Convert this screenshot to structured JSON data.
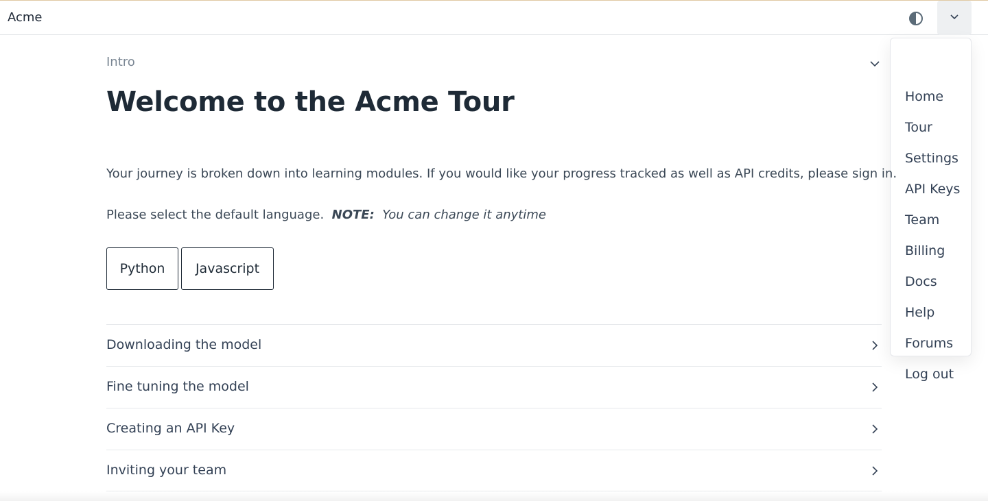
{
  "app": {
    "brand": "Acme"
  },
  "header": {
    "theme_icon": "contrast-icon",
    "menu_icon": "chevron-down-icon"
  },
  "menu": {
    "items": [
      {
        "label": "Home"
      },
      {
        "label": "Tour"
      },
      {
        "label": "Settings"
      },
      {
        "label": "API Keys"
      },
      {
        "label": "Team"
      },
      {
        "label": "Billing"
      },
      {
        "label": "Docs"
      },
      {
        "label": "Help"
      },
      {
        "label": "Forums"
      },
      {
        "label": "Log out"
      }
    ]
  },
  "section": {
    "label": "Intro",
    "title": "Welcome to the Acme Tour",
    "description": "Your journey is broken down into learning modules. If you would like your progress tracked as well as API credits, please sign in.",
    "language_prompt": "Please select the default language.",
    "note_label": "NOTE:",
    "note_text": "You can change it anytime"
  },
  "languages": [
    {
      "label": "Python"
    },
    {
      "label": "Javascript"
    }
  ],
  "modules": [
    {
      "label": "Downloading the model"
    },
    {
      "label": "Fine tuning the model"
    },
    {
      "label": "Creating an API Key"
    },
    {
      "label": "Inviting your team"
    }
  ],
  "colors": {
    "heading": "#1e2a36",
    "body_text": "#334155",
    "muted": "#7b8794",
    "accent_border": "#e0c9a3"
  }
}
